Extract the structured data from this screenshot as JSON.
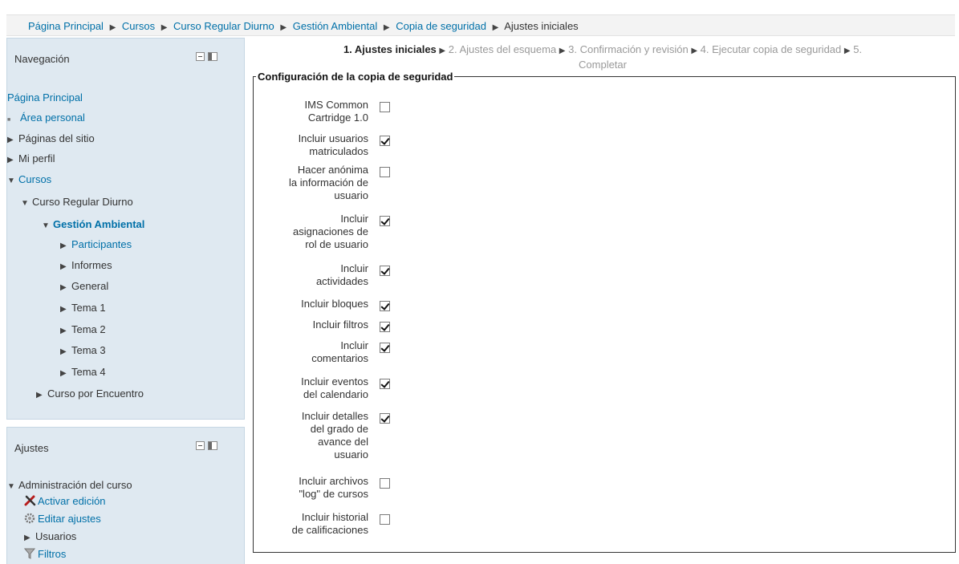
{
  "breadcrumb": {
    "items": [
      "Página Principal",
      "Cursos",
      "Curso Regular Diurno",
      "Gestión Ambiental",
      "Copia de seguridad",
      "Ajustes iniciales"
    ],
    "separator": "▶"
  },
  "navigation_block": {
    "title": "Navegación",
    "items": [
      {
        "label": "Página Principal"
      },
      {
        "label": "Área personal"
      },
      {
        "label": "Páginas del sitio"
      },
      {
        "label": "Mi perfil"
      },
      {
        "label": "Cursos"
      },
      {
        "label": "Curso Regular Diurno"
      },
      {
        "label": "Gestión Ambiental"
      },
      {
        "label": "Participantes"
      },
      {
        "label": "Informes"
      },
      {
        "label": "General"
      },
      {
        "label": "Tema 1"
      },
      {
        "label": "Tema 2"
      },
      {
        "label": "Tema 3"
      },
      {
        "label": "Tema 4"
      },
      {
        "label": "Curso por Encuentro"
      }
    ]
  },
  "settings_block": {
    "title": "Ajustes",
    "items": [
      {
        "label": "Administración del curso"
      },
      {
        "label": "Activar edición"
      },
      {
        "label": "Editar ajustes"
      },
      {
        "label": "Usuarios"
      },
      {
        "label": "Filtros"
      }
    ]
  },
  "steps": {
    "step1": "1. Ajustes iniciales",
    "step2": "2. Ajustes del esquema",
    "step3": "3. Confirmación y revisión",
    "step4": "4. Ejecutar copia de seguridad",
    "step5a": "5.",
    "step5b": "Completar",
    "separator": "▶"
  },
  "backup_settings": {
    "legend": "Configuración de la copia de seguridad",
    "options": [
      {
        "label": [
          "IMS Common",
          "Cartridge 1.0"
        ],
        "checked": false
      },
      {
        "label": [
          "Incluir usuarios",
          "matriculados"
        ],
        "checked": true
      },
      {
        "label": [
          "Hacer anónima",
          "la información de",
          "usuario"
        ],
        "checked": false
      },
      {
        "label": [
          "Incluir",
          "asignaciones de",
          "rol de usuario"
        ],
        "checked": true
      },
      {
        "label": [
          "Incluir",
          "actividades"
        ],
        "checked": true
      },
      {
        "label": [
          "Incluir bloques"
        ],
        "checked": true
      },
      {
        "label": [
          "Incluir filtros"
        ],
        "checked": true
      },
      {
        "label": [
          "Incluir",
          "comentarios"
        ],
        "checked": true
      },
      {
        "label": [
          "Incluir eventos",
          "del calendario"
        ],
        "checked": true
      },
      {
        "label": [
          "Incluir detalles",
          "del grado de",
          "avance del",
          "usuario"
        ],
        "checked": true
      },
      {
        "label": [
          "Incluir archivos",
          "\"log\" de cursos"
        ],
        "checked": false
      },
      {
        "label": [
          "Incluir historial",
          "de calificaciones"
        ],
        "checked": false
      }
    ]
  },
  "colors": {
    "link": "#0070a8",
    "block_bg": "#dfe9f1"
  }
}
